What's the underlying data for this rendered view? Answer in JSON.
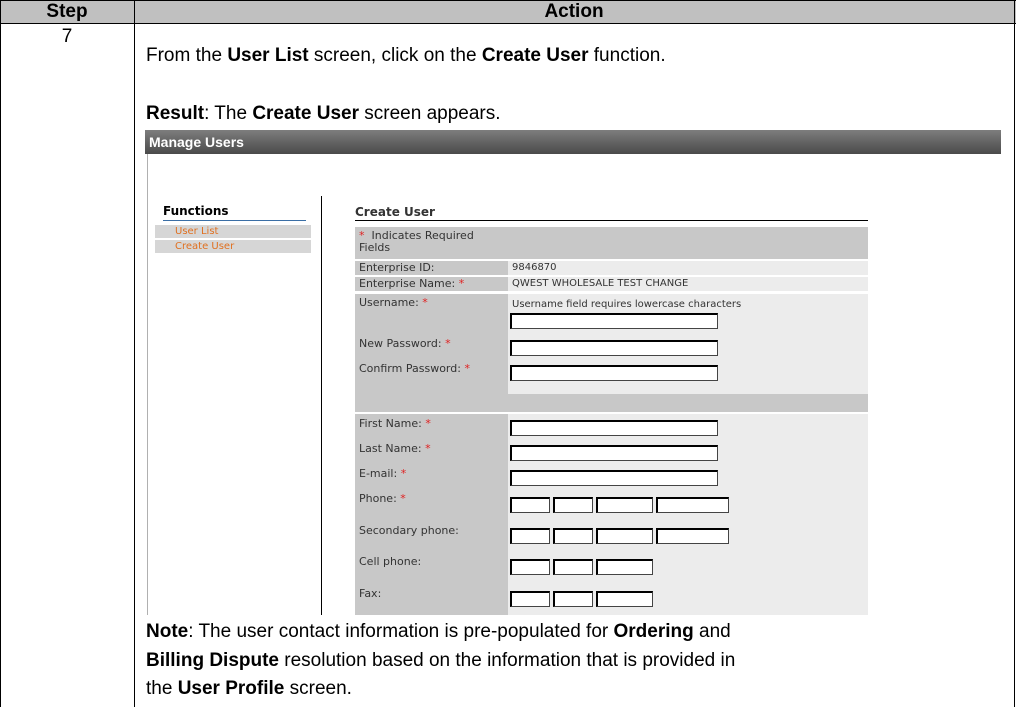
{
  "table": {
    "header_step": "Step",
    "header_action": "Action",
    "step_number": "7",
    "intro": {
      "pre": "From the ",
      "b1": "User List",
      "mid": " screen, click on the ",
      "b2": "Create User",
      "post": " function."
    },
    "result": {
      "b1": "Result",
      "mid1": ":  The ",
      "b2": "Create User",
      "post": " screen appears."
    },
    "note": {
      "b1": "Note",
      "l1_mid": ":  The user contact information is pre-populated for ",
      "b2": "Ordering",
      "l1_post": " and",
      "b3": "Billing Dispute",
      "l2_post": " resolution based on the information that is provided in",
      "l3_pre": "the ",
      "b4": "User Profile",
      "l3_post": " screen."
    }
  },
  "screenshot": {
    "window_title": "Manage Users",
    "functions_title": "Functions",
    "functions": [
      "User List",
      "Create User"
    ],
    "form_title": "Create User",
    "required_note": "Indicates Required Fields",
    "required_marker": "*",
    "fields": {
      "enterprise_id_label": "Enterprise ID:",
      "enterprise_id_value": "9846870",
      "enterprise_name_label": "Enterprise Name:",
      "enterprise_name_value": "QWEST WHOLESALE TEST CHANGE",
      "username_label": "Username:",
      "username_hint": "Username field requires lowercase characters",
      "new_password_label": "New Password:",
      "confirm_password_label": "Confirm Password:",
      "first_name_label": "First Name:",
      "last_name_label": "Last Name:",
      "email_label": "E-mail:",
      "phone_label": "Phone:",
      "secondary_phone_label": "Secondary phone:",
      "cell_phone_label": "Cell phone:",
      "fax_label": "Fax:"
    }
  }
}
